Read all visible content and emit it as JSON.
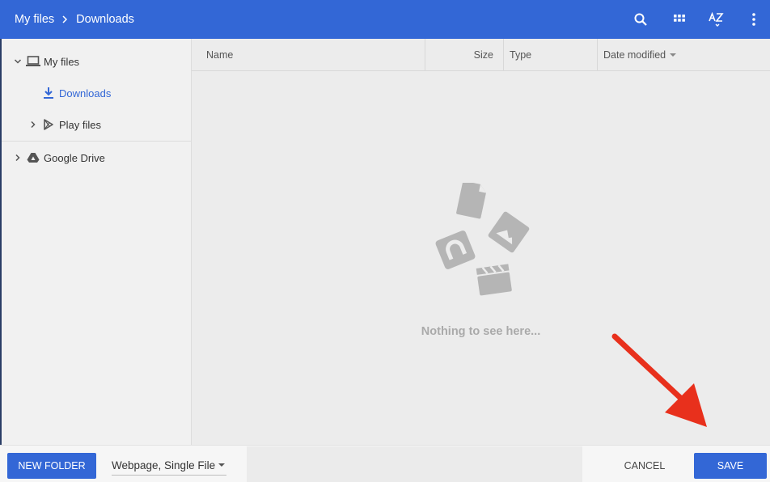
{
  "breadcrumb": {
    "root": "My files",
    "current": "Downloads"
  },
  "toolbar": {
    "icons": [
      "search-icon",
      "grid-view-icon",
      "sort-az-icon",
      "more-vert-icon"
    ]
  },
  "sidebar": {
    "items": [
      {
        "label": "My files",
        "icon": "laptop-icon",
        "expanded": true
      },
      {
        "label": "Downloads",
        "icon": "download-icon",
        "active": true
      },
      {
        "label": "Play files",
        "icon": "play-store-icon",
        "expanded": false
      },
      {
        "label": "Google Drive",
        "icon": "google-drive-icon",
        "expanded": false
      }
    ]
  },
  "columns": {
    "name": "Name",
    "size": "Size",
    "type": "Type",
    "date": "Date modified"
  },
  "empty_state": {
    "message": "Nothing to see here..."
  },
  "footer": {
    "new_folder": "NEW FOLDER",
    "file_type": "Webpage, Single File",
    "cancel": "CANCEL",
    "save": "SAVE"
  },
  "colors": {
    "accent": "#3367d6",
    "annotation": "#e8301c"
  }
}
